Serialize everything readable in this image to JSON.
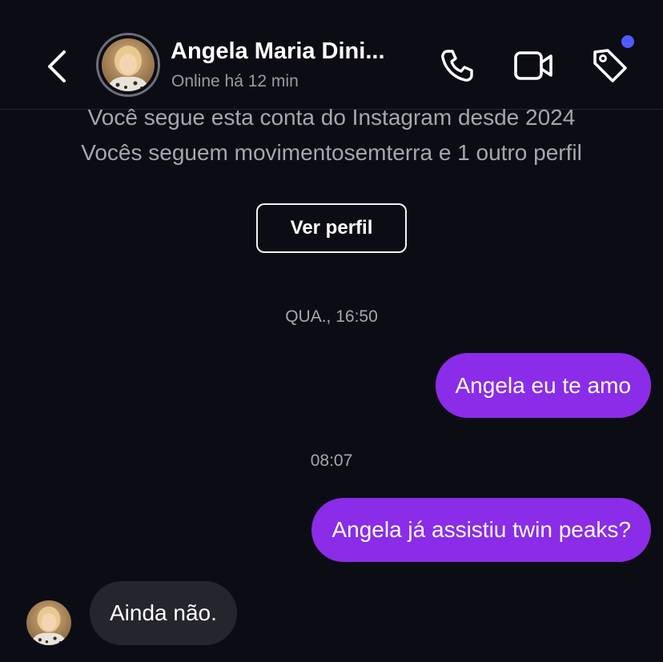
{
  "header": {
    "contact_name": "Angela Maria Dini...",
    "status": "Online há 12 min",
    "icons": {
      "back": "chevron-left-icon",
      "call": "phone-icon",
      "video": "video-camera-icon",
      "tag": "tag-icon"
    },
    "notification_dot_color": "#4f5bff"
  },
  "profile_info": {
    "follow_line_1": "Você segue esta conta do Instagram desde 2024",
    "follow_line_2": "Vocês seguem movimentosemterra e 1 outro perfil",
    "view_profile_label": "Ver perfil"
  },
  "messages": [
    {
      "type": "timestamp",
      "text": "QUA., 16:50"
    },
    {
      "type": "outgoing",
      "text": "Angela eu te amo"
    },
    {
      "type": "timestamp",
      "text": "08:07"
    },
    {
      "type": "outgoing",
      "text": "Angela já assistiu twin peaks?"
    },
    {
      "type": "incoming",
      "text": "Ainda não."
    }
  ],
  "colors": {
    "background": "#0c0c14",
    "outgoing_bubble": "#8a2ce8",
    "incoming_bubble": "#25252d",
    "secondary_text": "#a6a6ae"
  }
}
